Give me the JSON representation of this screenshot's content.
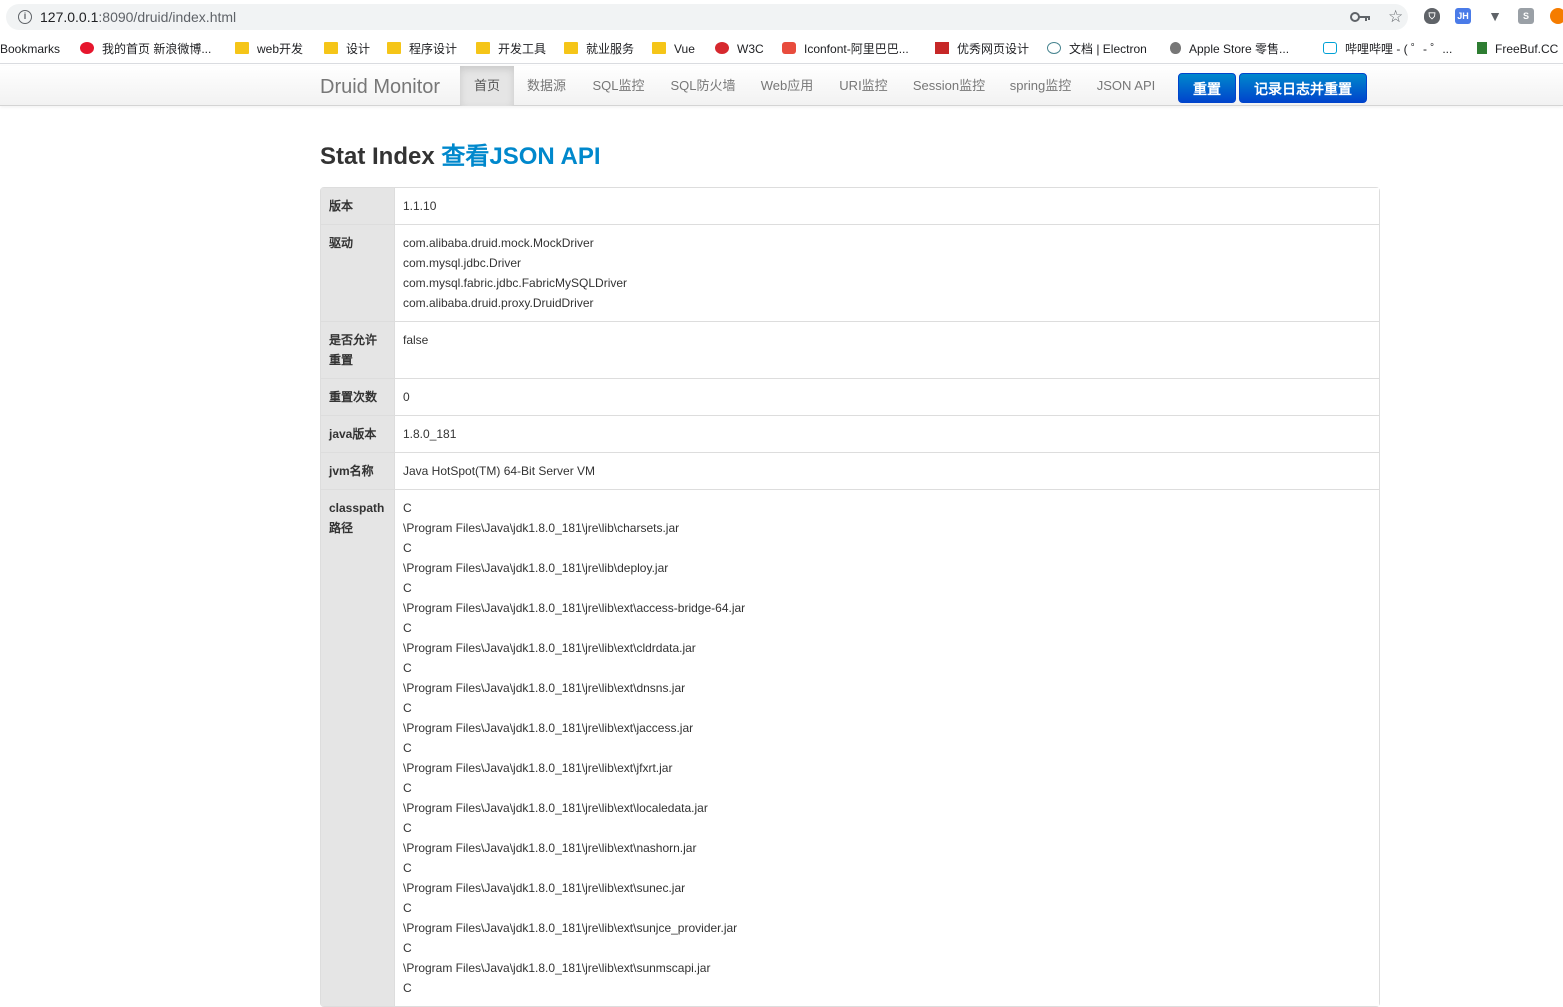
{
  "browser": {
    "url_host": "127.0.0.1",
    "url_rest": ":8090/druid/index.html",
    "bookmarks": [
      {
        "label": "Bookmarks",
        "icon": "none"
      },
      {
        "label": "我的首页 新浪微博...",
        "icon": "weibo-icon"
      },
      {
        "label": "web开发",
        "icon": "folder-icon"
      },
      {
        "label": "设计",
        "icon": "folder-icon"
      },
      {
        "label": "程序设计",
        "icon": "folder-icon"
      },
      {
        "label": "开发工具",
        "icon": "folder-icon"
      },
      {
        "label": "就业服务",
        "icon": "folder-icon"
      },
      {
        "label": "Vue",
        "icon": "folder-icon"
      },
      {
        "label": "W3C",
        "icon": "w3c-icon"
      },
      {
        "label": "Iconfont-阿里巴巴...",
        "icon": "iconfont-icon"
      },
      {
        "label": "优秀网页设计",
        "icon": "design-icon"
      },
      {
        "label": "文档 | Electron",
        "icon": "electron-icon"
      },
      {
        "label": "Apple Store 零售...",
        "icon": "apple-icon"
      },
      {
        "label": "哔哩哔哩 - ( ゜- ゜...",
        "icon": "bilibili-icon"
      },
      {
        "label": "FreeBuf.CC",
        "icon": "freebuf-icon"
      }
    ],
    "extensions": [
      "JH",
      "S"
    ]
  },
  "navbar": {
    "brand": "Druid Monitor",
    "items": [
      {
        "label": "首页",
        "active": true
      },
      {
        "label": "数据源"
      },
      {
        "label": "SQL监控"
      },
      {
        "label": "SQL防火墙"
      },
      {
        "label": "Web应用"
      },
      {
        "label": "URI监控"
      },
      {
        "label": "Session监控"
      },
      {
        "label": "spring监控"
      },
      {
        "label": "JSON API"
      }
    ],
    "reset_label": "重置",
    "log_reset_label": "记录日志并重置"
  },
  "page": {
    "title": "Stat Index",
    "json_link": "查看JSON API"
  },
  "stats": {
    "version": {
      "label": "版本",
      "value": "1.1.10"
    },
    "drivers": {
      "label": "驱动",
      "values": [
        "com.alibaba.druid.mock.MockDriver",
        "com.mysql.jdbc.Driver",
        "com.mysql.fabric.jdbc.FabricMySQLDriver",
        "com.alibaba.druid.proxy.DruidDriver"
      ]
    },
    "reset_enable": {
      "label": "是否允许重置",
      "value": "false"
    },
    "reset_count": {
      "label": "重置次数",
      "value": "0"
    },
    "java_version": {
      "label": "java版本",
      "value": "1.8.0_181"
    },
    "jvm_name": {
      "label": "jvm名称",
      "value": "Java HotSpot(TM) 64-Bit Server VM"
    },
    "classpath": {
      "label": "classpath路径",
      "values": [
        "C",
        "\\Program Files\\Java\\jdk1.8.0_181\\jre\\lib\\charsets.jar",
        "C",
        "\\Program Files\\Java\\jdk1.8.0_181\\jre\\lib\\deploy.jar",
        "C",
        "\\Program Files\\Java\\jdk1.8.0_181\\jre\\lib\\ext\\access-bridge-64.jar",
        "C",
        "\\Program Files\\Java\\jdk1.8.0_181\\jre\\lib\\ext\\cldrdata.jar",
        "C",
        "\\Program Files\\Java\\jdk1.8.0_181\\jre\\lib\\ext\\dnsns.jar",
        "C",
        "\\Program Files\\Java\\jdk1.8.0_181\\jre\\lib\\ext\\jaccess.jar",
        "C",
        "\\Program Files\\Java\\jdk1.8.0_181\\jre\\lib\\ext\\jfxrt.jar",
        "C",
        "\\Program Files\\Java\\jdk1.8.0_181\\jre\\lib\\ext\\localedata.jar",
        "C",
        "\\Program Files\\Java\\jdk1.8.0_181\\jre\\lib\\ext\\nashorn.jar",
        "C",
        "\\Program Files\\Java\\jdk1.8.0_181\\jre\\lib\\ext\\sunec.jar",
        "C",
        "\\Program Files\\Java\\jdk1.8.0_181\\jre\\lib\\ext\\sunjce_provider.jar",
        "C",
        "\\Program Files\\Java\\jdk1.8.0_181\\jre\\lib\\ext\\sunmscapi.jar",
        "C"
      ]
    }
  },
  "colors": {
    "link": "#0088cc",
    "primary_button": "#0066cc",
    "label_bg": "#e5e5e5"
  }
}
